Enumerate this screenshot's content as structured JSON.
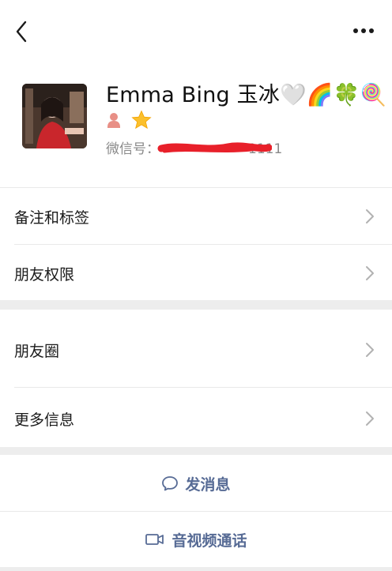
{
  "topbar": {
    "back_icon": "chevron-left-icon",
    "more_icon": "more-dots-icon"
  },
  "profile": {
    "name": "Emma Bing 玉冰🤍🌈🍀🍭",
    "badges": [
      "person-icon",
      "star-icon"
    ],
    "wechat_id_label": "微信号：",
    "wechat_id_value": "1111",
    "accent_red": "#e8202a"
  },
  "menu": {
    "remark_tags": "备注和标签",
    "friend_permissions": "朋友权限",
    "moments": "朋友圈",
    "more_info": "更多信息"
  },
  "actions": {
    "send_message": "发消息",
    "video_call": "音视频通话"
  },
  "colors": {
    "link_blue": "#576b95",
    "section_gap": "#ededed",
    "divider": "#e9e9e9"
  }
}
